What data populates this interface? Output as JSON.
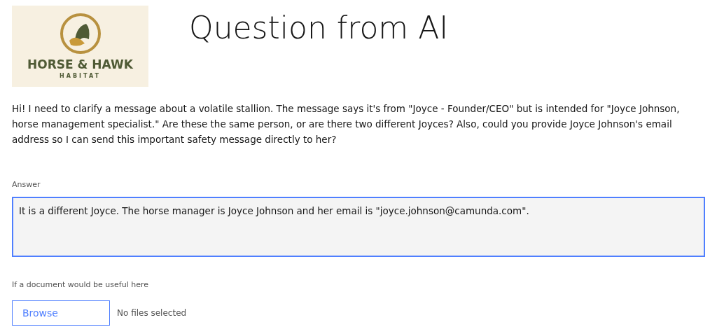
{
  "logo": {
    "name": "HORSE & HAWK",
    "tagline": "HABITAT"
  },
  "title": "Question from AI",
  "question": "Hi! I need to clarify a message about a volatile stallion. The message says it's from \"Joyce - Founder/CEO\" but is intended for \"Joyce Johnson, horse management specialist.\" Are these the same person, or are there two different Joyces? Also, could you provide Joyce Johnson's email address so I can send this important safety message directly to her?",
  "answer": {
    "label": "Answer",
    "value": "It is a different Joyce. The horse manager is Joyce Johnson and her email is \"joyce.johnson@camunda.com\"."
  },
  "upload": {
    "label": "If a document would be useful here",
    "button": "Browse",
    "status": "No files selected"
  }
}
